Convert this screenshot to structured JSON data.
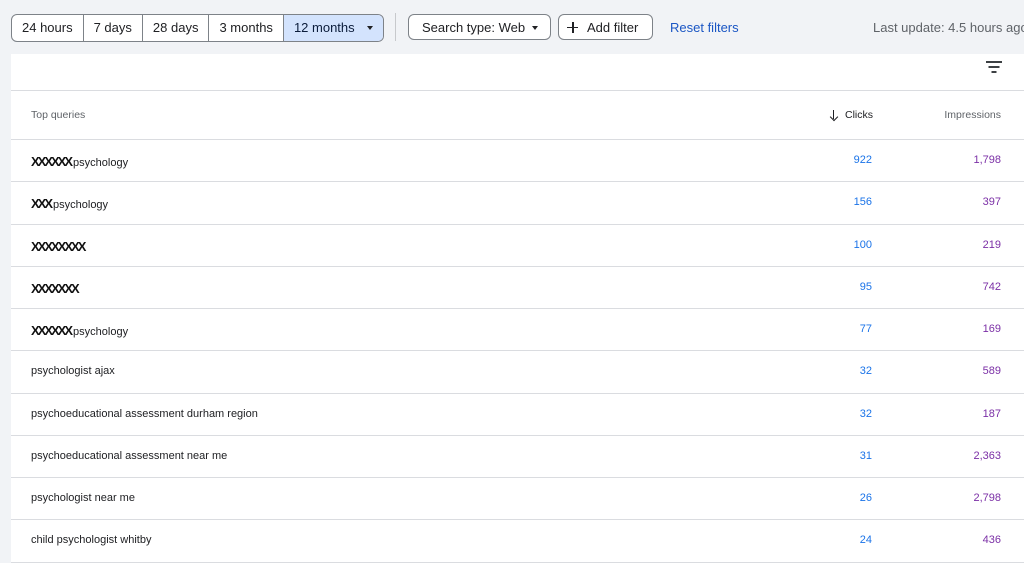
{
  "toolbar": {
    "date_ranges": [
      "24 hours",
      "7 days",
      "28 days",
      "3 months",
      "12 months"
    ],
    "search_type_label": "Search type: Web",
    "add_filter_label": "Add filter",
    "reset_filters_label": "Reset filters",
    "last_update": "Last update: 4.5 hours ago"
  },
  "table": {
    "headers": {
      "query": "Top queries",
      "clicks": "Clicks",
      "impressions": "Impressions"
    },
    "rows": [
      {
        "query_redacted": "XXXXXX",
        "query_text": "psychology",
        "clicks": "922",
        "impressions": "1,798"
      },
      {
        "query_redacted": "XXX",
        "query_text": "psychology",
        "clicks": "156",
        "impressions": "397"
      },
      {
        "query_redacted": "XXXXXXXX",
        "query_text": "",
        "clicks": "100",
        "impressions": "219"
      },
      {
        "query_redacted": "XXXXXXX",
        "query_text": "",
        "clicks": "95",
        "impressions": "742"
      },
      {
        "query_redacted": "XXXXXX",
        "query_text": "psychology",
        "clicks": "77",
        "impressions": "169"
      },
      {
        "query_redacted": "",
        "query_text": "psychologist ajax",
        "clicks": "32",
        "impressions": "589"
      },
      {
        "query_redacted": "",
        "query_text": "psychoeducational assessment durham region",
        "clicks": "32",
        "impressions": "187"
      },
      {
        "query_redacted": "",
        "query_text": "psychoeducational assessment near me",
        "clicks": "31",
        "impressions": "2,363"
      },
      {
        "query_redacted": "",
        "query_text": "psychologist near me",
        "clicks": "26",
        "impressions": "2,798"
      },
      {
        "query_redacted": "",
        "query_text": "child psychologist whitby",
        "clicks": "24",
        "impressions": "436"
      }
    ]
  },
  "colors": {
    "selected_range_bg": "#d3e3fd",
    "link": "#1a56c4",
    "clicks": "#1a73e8",
    "impressions": "#7b2fa6"
  }
}
